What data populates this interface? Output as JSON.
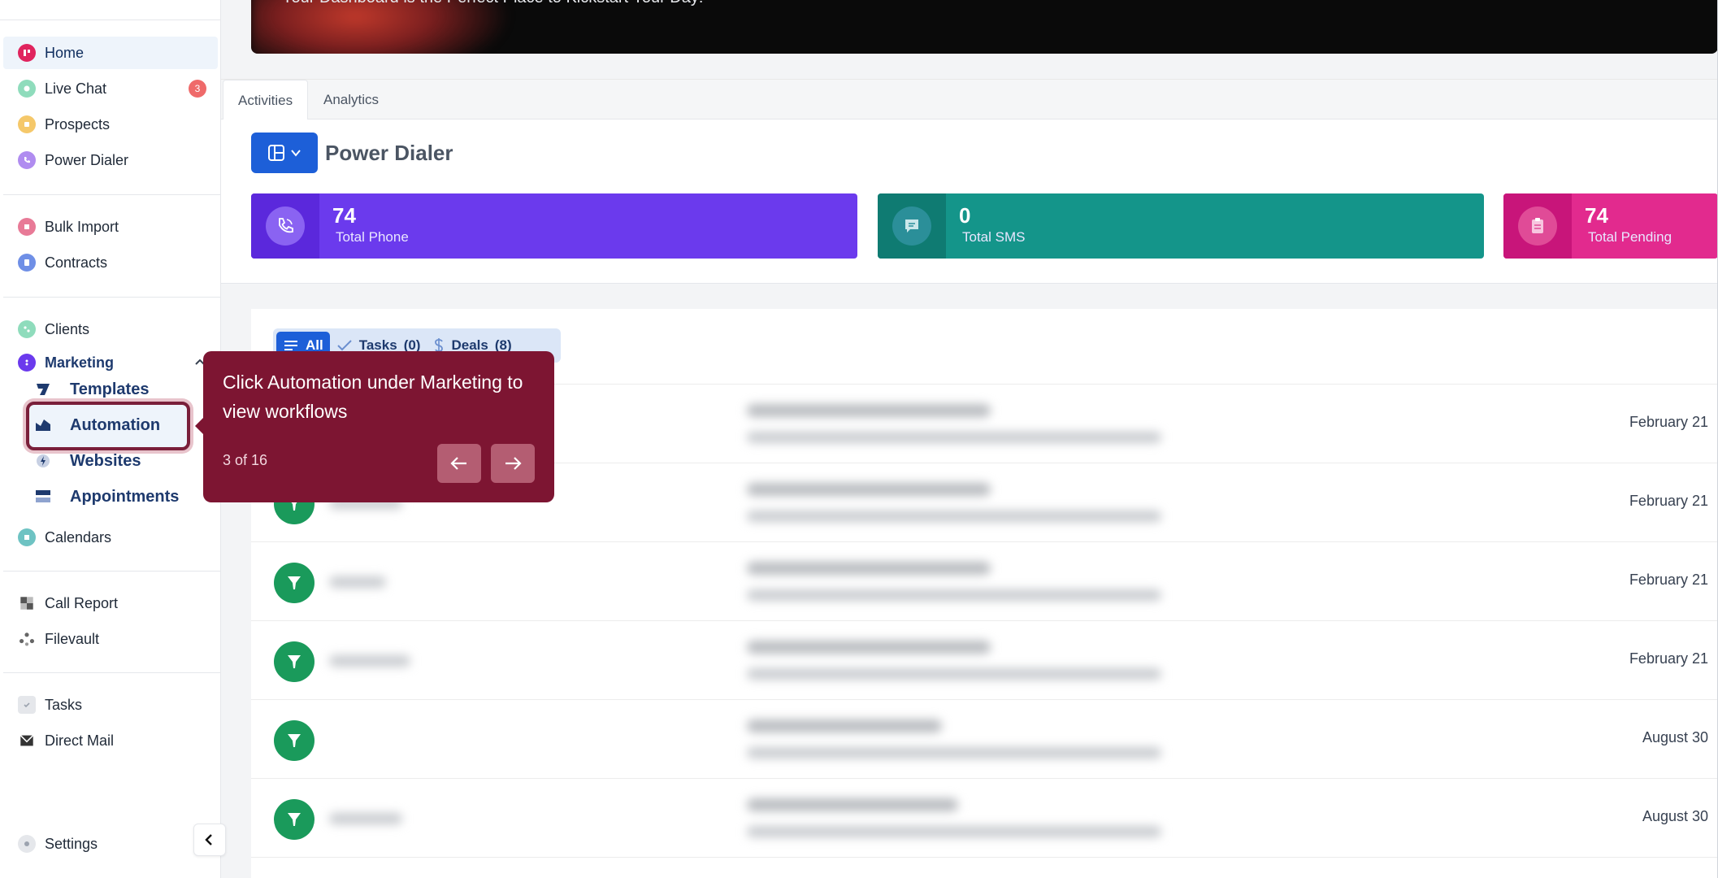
{
  "colors": {
    "brand_blue": "#1d5fd8",
    "tooltip_bg": "#7d1532",
    "card_phone": "#6b3aed",
    "card_sms": "#14958a",
    "card_pending": "#e22a8e",
    "avatar_green": "#1a9a5b"
  },
  "sidebar": {
    "items": [
      {
        "label": "Home",
        "icon": "home-icon",
        "color": "#e0245e"
      },
      {
        "label": "Live Chat",
        "icon": "chat-icon",
        "color": "#4fc99a",
        "badge": "3"
      },
      {
        "label": "Prospects",
        "icon": "prospects-icon",
        "color": "#f0b23d"
      },
      {
        "label": "Power Dialer",
        "icon": "phone-icon",
        "color": "#9b6fe8"
      },
      {
        "label": "Bulk Import",
        "icon": "import-icon",
        "color": "#e0587f"
      },
      {
        "label": "Contracts",
        "icon": "contracts-icon",
        "color": "#5a7fe0"
      },
      {
        "label": "Clients",
        "icon": "clients-icon",
        "color": "#4fc99a"
      },
      {
        "label": "Marketing",
        "icon": "marketing-icon",
        "color": "#6b3aed"
      },
      {
        "label": "Calendars",
        "icon": "calendar-icon",
        "color": "#3fb0b0"
      },
      {
        "label": "Call Report",
        "icon": "report-icon",
        "color": "#444"
      },
      {
        "label": "Filevault",
        "icon": "filevault-icon",
        "color": "#555"
      },
      {
        "label": "Tasks",
        "icon": "tasks-icon",
        "color": "#bbb"
      },
      {
        "label": "Direct Mail",
        "icon": "mail-icon",
        "color": "#333"
      },
      {
        "label": "Settings",
        "icon": "settings-icon",
        "color": "#bbb"
      }
    ],
    "marketing_sub": [
      {
        "label": "Templates",
        "icon": "templates-icon"
      },
      {
        "label": "Automation",
        "icon": "automation-icon"
      },
      {
        "label": "Websites",
        "icon": "websites-icon"
      },
      {
        "label": "Appointments",
        "icon": "appointments-icon"
      }
    ]
  },
  "hero": {
    "text": "Your Dashboard is the Perfect Place to Kickstart Your Day!"
  },
  "tabs": [
    {
      "label": "Activities",
      "active": true
    },
    {
      "label": "Analytics",
      "active": false
    }
  ],
  "power_dialer": {
    "title": "Power Dialer",
    "cards": [
      {
        "value": "74",
        "label": "Total Phone",
        "icon": "phone-call-icon"
      },
      {
        "value": "0",
        "label": "Total SMS",
        "icon": "sms-icon"
      },
      {
        "value": "74",
        "label": "Total Pending",
        "icon": "clipboard-icon"
      }
    ]
  },
  "filters": [
    {
      "label": "All",
      "icon": "list-icon",
      "active": true
    },
    {
      "label": "Tasks",
      "count": "(0)",
      "icon": "check-icon"
    },
    {
      "label": "Deals",
      "count": "(8)",
      "icon": "dollar-icon"
    }
  ],
  "activities": [
    {
      "date": "February 21"
    },
    {
      "date": "February 21"
    },
    {
      "date": "February 21"
    },
    {
      "date": "February 21"
    },
    {
      "date": "August 30"
    },
    {
      "date": "August 30"
    }
  ],
  "tooltip": {
    "message": "Click Automation under Marketing to view workflows",
    "step": "3 of 16"
  }
}
